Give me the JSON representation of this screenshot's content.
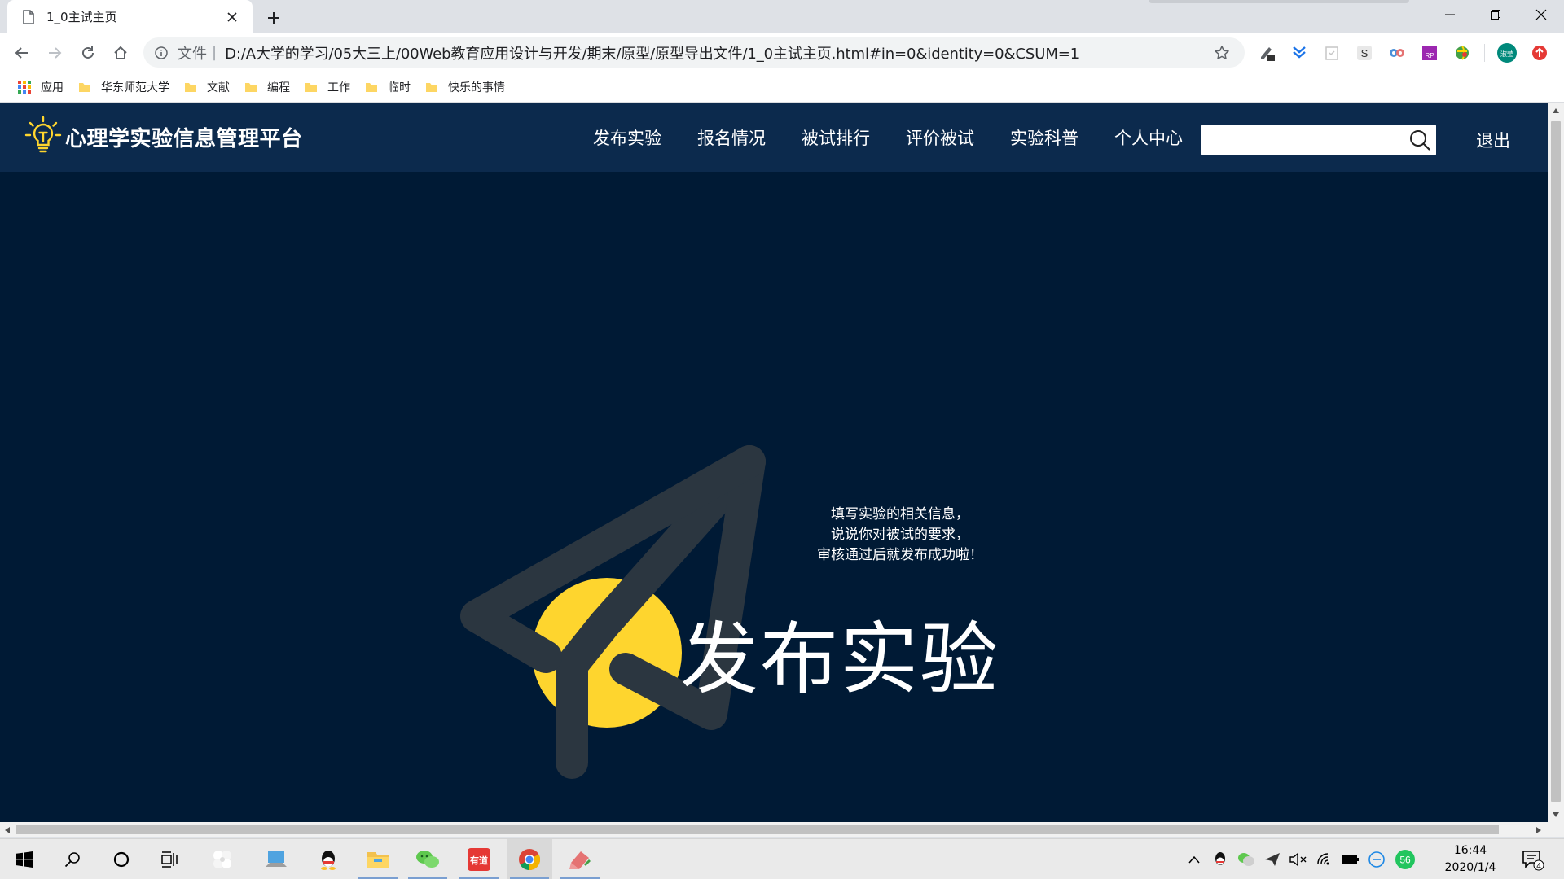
{
  "browser": {
    "tab": {
      "title": "1_0主试主页"
    },
    "address": {
      "scheme_label": "文件",
      "url": "D:/A大学的学习/05大三上/00Web教育应用设计与开发/期末/原型/原型导出文件/1_0主试主页.html#in=0&identity=0&CSUM=1"
    },
    "bookmarks": [
      {
        "label": "应用",
        "icon": "apps-grid-icon"
      },
      {
        "label": "华东师范大学",
        "icon": "folder-icon"
      },
      {
        "label": "文献",
        "icon": "folder-icon"
      },
      {
        "label": "编程",
        "icon": "folder-icon"
      },
      {
        "label": "工作",
        "icon": "folder-icon"
      },
      {
        "label": "临时",
        "icon": "folder-icon"
      },
      {
        "label": "快乐的事情",
        "icon": "folder-icon"
      }
    ],
    "extensions": [
      {
        "name": "pen-extension-icon"
      },
      {
        "name": "chevrons-extension-icon"
      },
      {
        "name": "clipboard-extension-icon"
      },
      {
        "name": "s-extension-icon",
        "text": "S"
      },
      {
        "name": "owl-extension-icon"
      },
      {
        "name": "rp-extension-icon",
        "text": "RP"
      },
      {
        "name": "globe-extension-icon"
      },
      {
        "name": "profile-avatar-icon",
        "text": "淑莹"
      },
      {
        "name": "update-icon"
      }
    ]
  },
  "site": {
    "logo_text": "心理学实验信息管理平台",
    "nav": [
      {
        "label": "发布实验"
      },
      {
        "label": "报名情况"
      },
      {
        "label": "被试排行"
      },
      {
        "label": "评价被试"
      },
      {
        "label": "实验科普"
      },
      {
        "label": "个人中心"
      }
    ],
    "search": {
      "value": "",
      "placeholder": ""
    },
    "logout_label": "退出",
    "hero": {
      "desc_lines": [
        "填写实验的相关信息，",
        "说说你对被试的要求，",
        "审核通过后就发布成功啦！"
      ],
      "title": "发布实验"
    },
    "colors": {
      "header_bg": "#0c2a4d",
      "page_bg": "#001a35",
      "accent_yellow": "#fed52e",
      "plane_gray": "#2b3640"
    }
  },
  "taskbar": {
    "clock_time": "16:44",
    "clock_date": "2020/1/4",
    "notification_count": "4",
    "tray_badge": "56",
    "pinned": [
      {
        "name": "windows-start-icon"
      },
      {
        "name": "search-icon"
      },
      {
        "name": "cortana-icon"
      },
      {
        "name": "task-view-icon"
      },
      {
        "name": "pinwheel-app-icon"
      },
      {
        "name": "computer-app-icon"
      },
      {
        "name": "qq-app-icon"
      },
      {
        "name": "file-explorer-icon"
      },
      {
        "name": "wechat-app-icon"
      },
      {
        "name": "youdao-app-icon",
        "text": "有道"
      },
      {
        "name": "chrome-app-icon"
      },
      {
        "name": "axure-app-icon"
      }
    ]
  }
}
